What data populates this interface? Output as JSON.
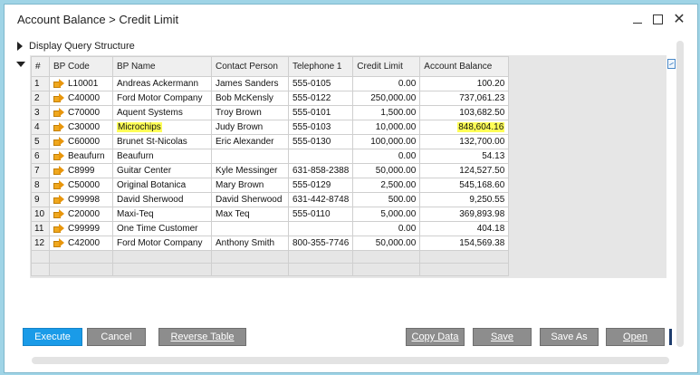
{
  "window": {
    "title": "Account Balance > Credit Limit"
  },
  "query_structure": {
    "label": "Display Query Structure"
  },
  "grid": {
    "columns": [
      "#",
      "BP Code",
      "BP Name",
      "Contact Person",
      "Telephone 1",
      "Credit Limit",
      "Account Balance"
    ],
    "rows": [
      {
        "num": "1",
        "code": "L10001",
        "name": "Andreas Ackermann",
        "contact": "James Sanders",
        "phone": "555-0105",
        "credit": "0.00",
        "balance": "100.20"
      },
      {
        "num": "2",
        "code": "C40000",
        "name": "Ford Motor Company",
        "contact": "Bob McKensly",
        "phone": "555-0122",
        "credit": "250,000.00",
        "balance": "737,061.23"
      },
      {
        "num": "3",
        "code": "C70000",
        "name": "Aquent Systems",
        "contact": "Troy Brown",
        "phone": "555-0101",
        "credit": "1,500.00",
        "balance": "103,682.50"
      },
      {
        "num": "4",
        "code": "C30000",
        "name": "Microchips",
        "contact": "Judy Brown",
        "phone": "555-0103",
        "credit": "10,000.00",
        "balance": "848,604.16"
      },
      {
        "num": "5",
        "code": "C60000",
        "name": "Brunet St-Nicolas",
        "contact": "Eric Alexander",
        "phone": "555-0130",
        "credit": "100,000.00",
        "balance": "132,700.00"
      },
      {
        "num": "6",
        "code": "Beaufurn",
        "name": "Beaufurn",
        "contact": "",
        "phone": "",
        "credit": "0.00",
        "balance": "54.13"
      },
      {
        "num": "7",
        "code": "C8999",
        "name": "Guitar Center",
        "contact": "Kyle Messinger",
        "phone": "631-858-2388",
        "credit": "50,000.00",
        "balance": "124,527.50"
      },
      {
        "num": "8",
        "code": "C50000",
        "name": "Original Botanica",
        "contact": "Mary Brown",
        "phone": "555-0129",
        "credit": "2,500.00",
        "balance": "545,168.60"
      },
      {
        "num": "9",
        "code": "C99998",
        "name": "David Sherwood",
        "contact": "David Sherwood",
        "phone": "631-442-8748",
        "credit": "500.00",
        "balance": "9,250.55"
      },
      {
        "num": "10",
        "code": "C20000",
        "name": "Maxi-Teq",
        "contact": "Max Teq",
        "phone": "555-0110",
        "credit": "5,000.00",
        "balance": "369,893.98"
      },
      {
        "num": "11",
        "code": "C99999",
        "name": "One Time Customer",
        "contact": "",
        "phone": "",
        "credit": "0.00",
        "balance": "404.18"
      },
      {
        "num": "12",
        "code": "C42000",
        "name": "Ford Motor Company",
        "contact": "Anthony Smith",
        "phone": "800-355-7746",
        "credit": "50,000.00",
        "balance": "154,569.38"
      }
    ],
    "highlight_color": "#ffff57",
    "link_arrow_color": "#f0a81e"
  },
  "buttons": {
    "execute": "Execute",
    "cancel": "Cancel",
    "reverse": "Reverse Table",
    "copy": "Copy Data",
    "save": "Save",
    "saveas": "Save As",
    "open": "Open"
  },
  "colors": {
    "primary_button": "#1a9be8",
    "secondary_button": "#8d8d8d",
    "window_border": "#7fb8cc"
  }
}
